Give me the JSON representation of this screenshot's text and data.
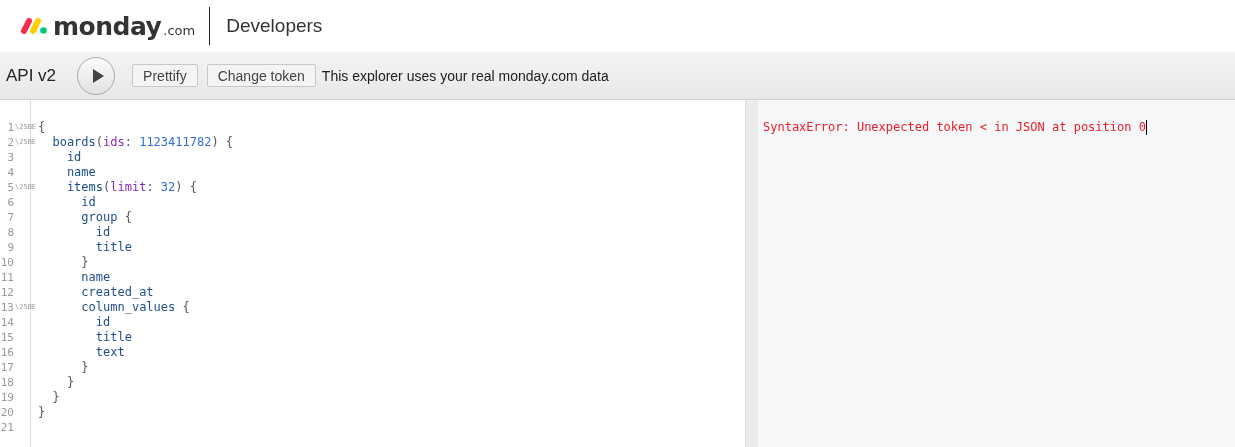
{
  "header": {
    "logo_word": "monday",
    "logo_suffix": ".com",
    "section": "Developers"
  },
  "toolbar": {
    "title": "API v2",
    "buttons": [
      "Prettify",
      "Change token"
    ],
    "notice": "This explorer uses your real monday.com data"
  },
  "editor": {
    "lines": [
      {
        "number": "1",
        "fold": "\\25BE",
        "tokens": [
          {
            "text": "{",
            "kind": "punct"
          }
        ]
      },
      {
        "number": "2",
        "fold": "\\25BE",
        "tokens": [
          {
            "text": "  boards",
            "kind": "field"
          },
          {
            "text": "(",
            "kind": "punct"
          },
          {
            "text": "ids",
            "kind": "attribute"
          },
          {
            "text": ": ",
            "kind": "punct"
          },
          {
            "text": "1123411782",
            "kind": "number"
          },
          {
            "text": ") {",
            "kind": "punct"
          }
        ]
      },
      {
        "number": "3",
        "tokens": [
          {
            "text": "    id",
            "kind": "field"
          }
        ]
      },
      {
        "number": "4",
        "tokens": [
          {
            "text": "    name",
            "kind": "field"
          }
        ]
      },
      {
        "number": "5",
        "fold": "\\25BE",
        "tokens": [
          {
            "text": "    items",
            "kind": "field"
          },
          {
            "text": "(",
            "kind": "punct"
          },
          {
            "text": "limit",
            "kind": "attribute"
          },
          {
            "text": ": ",
            "kind": "punct"
          },
          {
            "text": "32",
            "kind": "number"
          },
          {
            "text": ") {",
            "kind": "punct"
          }
        ]
      },
      {
        "number": "6",
        "tokens": [
          {
            "text": "      id",
            "kind": "field"
          }
        ]
      },
      {
        "number": "7",
        "tokens": [
          {
            "text": "      group",
            "kind": "field"
          },
          {
            "text": " {",
            "kind": "punct"
          }
        ]
      },
      {
        "number": "8",
        "tokens": [
          {
            "text": "        id",
            "kind": "field"
          }
        ]
      },
      {
        "number": "9",
        "tokens": [
          {
            "text": "        title",
            "kind": "field"
          }
        ]
      },
      {
        "number": "10",
        "tokens": [
          {
            "text": "      }",
            "kind": "punct"
          }
        ]
      },
      {
        "number": "11",
        "tokens": [
          {
            "text": "      name",
            "kind": "field"
          }
        ]
      },
      {
        "number": "12",
        "tokens": [
          {
            "text": "      created_at",
            "kind": "field"
          }
        ]
      },
      {
        "number": "13",
        "fold": "\\25BE",
        "tokens": [
          {
            "text": "      column_values",
            "kind": "field"
          },
          {
            "text": " {",
            "kind": "punct"
          }
        ]
      },
      {
        "number": "14",
        "tokens": [
          {
            "text": "        id",
            "kind": "field"
          }
        ]
      },
      {
        "number": "15",
        "tokens": [
          {
            "text": "        title",
            "kind": "field"
          }
        ]
      },
      {
        "number": "16",
        "tokens": [
          {
            "text": "        text",
            "kind": "field"
          }
        ]
      },
      {
        "number": "17",
        "tokens": [
          {
            "text": "      }",
            "kind": "punct"
          }
        ]
      },
      {
        "number": "18",
        "tokens": [
          {
            "text": "    }",
            "kind": "punct"
          }
        ]
      },
      {
        "number": "19",
        "tokens": [
          {
            "text": "  }",
            "kind": "punct"
          }
        ]
      },
      {
        "number": "20",
        "tokens": [
          {
            "text": "}",
            "kind": "punct"
          }
        ]
      },
      {
        "number": "21"
      }
    ]
  },
  "result": {
    "error": "SyntaxError: Unexpected token < in JSON at position 0"
  }
}
